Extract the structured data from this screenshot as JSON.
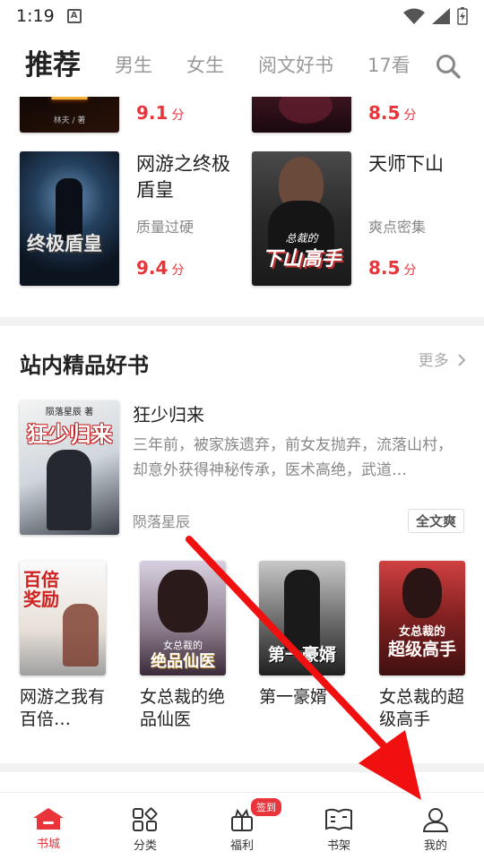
{
  "status": {
    "time": "1:19",
    "sim_glyph": "A"
  },
  "topnav": {
    "tabs": [
      "推荐",
      "男生",
      "女生",
      "阅文好书",
      "17看"
    ],
    "active": 0
  },
  "top_grid": [
    {
      "title": "",
      "author": "",
      "score": "9.1",
      "unit": "分",
      "cover_text": "",
      "cover_author": "林夫 / 著"
    },
    {
      "title": "",
      "author": "",
      "score": "8.5",
      "unit": "分",
      "cover_text": "",
      "cover_author": ""
    }
  ],
  "grid": [
    {
      "title": "网游之终极盾皇",
      "author": "质量过硬",
      "score": "9.4",
      "unit": "分",
      "cover_text": "终极盾皇"
    },
    {
      "title": "天师下山",
      "author": "爽点密集",
      "score": "8.5",
      "unit": "分",
      "cover_text": "下山高手",
      "cover_sub": "总裁的"
    }
  ],
  "section": {
    "title": "站内精品好书",
    "more": "更多",
    "feature": {
      "title": "狂少归来",
      "desc": "三年前，被家族遗弃，前女友抛弃，流落山村，却意外获得神秘传承，医术高绝，武道…",
      "author": "陨落星辰",
      "tag": "全文爽",
      "cover_text": "狂少归来",
      "cover_author": "陨落星辰 著"
    },
    "minis": [
      {
        "title": "网游之我有百倍…",
        "cover_text": "百倍奖励"
      },
      {
        "title": "女总裁的绝品仙医",
        "cover_text": "绝品仙医",
        "cover_sub": "女总裁的"
      },
      {
        "title": "第一豪婿",
        "cover_text": "第一豪婿"
      },
      {
        "title": "女总裁的超级高手",
        "cover_text": "超级高手",
        "cover_sub": "女总裁的"
      }
    ]
  },
  "bottomnav": [
    {
      "label": "书城",
      "icon": "home-icon",
      "active": true
    },
    {
      "label": "分类",
      "icon": "category-icon",
      "active": false
    },
    {
      "label": "福利",
      "icon": "gift-icon",
      "active": false,
      "badge": "签到"
    },
    {
      "label": "书架",
      "icon": "bookshelf-icon",
      "active": false
    },
    {
      "label": "我的",
      "icon": "profile-icon",
      "active": false
    }
  ],
  "colors": {
    "accent": "#e8343a",
    "muted": "#999999",
    "divider": "#f2f2f2"
  }
}
